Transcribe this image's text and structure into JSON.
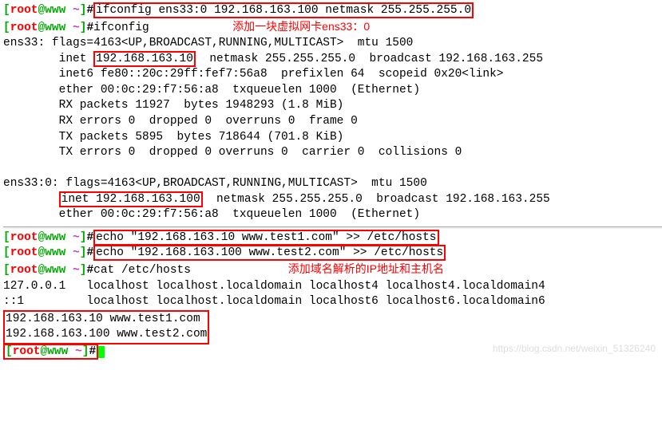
{
  "prompt": {
    "user": "root",
    "host": "www",
    "dir": "~",
    "sym": "#"
  },
  "cmd1": "ifconfig ens33:0 192.168.163.100 netmask 255.255.255.0",
  "cmd2": "ifconfig",
  "annotation1": "添加一块虚拟网卡ens33：0",
  "ens33": {
    "header": "ens33: flags=4163<UP,BROADCAST,RUNNING,MULTICAST>  mtu 1500",
    "inet_prefix": "        inet ",
    "inet_ip": "192.168.163.10",
    "inet_rest": "  netmask 255.255.255.0  broadcast 192.168.163.255",
    "inet6": "        inet6 fe80::20c:29ff:fef7:56a8  prefixlen 64  scopeid 0x20<link>",
    "ether": "        ether 00:0c:29:f7:56:a8  txqueuelen 1000  (Ethernet)",
    "rxp": "        RX packets 11927  bytes 1948293 (1.8 MiB)",
    "rxe": "        RX errors 0  dropped 0  overruns 0  frame 0",
    "txp": "        TX packets 5895  bytes 718644 (701.8 KiB)",
    "txe": "        TX errors 0  dropped 0 overruns 0  carrier 0  collisions 0"
  },
  "ens33_0": {
    "header": "ens33:0: flags=4163<UP,BROADCAST,RUNNING,MULTICAST>  mtu 1500",
    "inet_prefix": "        ",
    "inet_box": "inet 192.168.163.100",
    "inet_rest": "  netmask 255.255.255.0  broadcast 192.168.163.255",
    "ether": "        ether 00:0c:29:f7:56:a8  txqueuelen 1000  (Ethernet)"
  },
  "cmd3": "echo \"192.168.163.10 www.test1.com\" >> /etc/hosts",
  "cmd4": "echo \"192.168.163.100 www.test2.com\" >> /etc/hosts",
  "cmd5": "cat /etc/hosts",
  "annotation2": "添加域名解析的IP地址和主机名",
  "hosts": {
    "l1": "127.0.0.1   localhost localhost.localdomain localhost4 localhost4.localdomain4",
    "l2": "::1         localhost localhost.localdomain localhost6 localhost6.localdomain6",
    "l3": "192.168.163.10 www.test1.com",
    "l4": "192.168.163.100 www.test2.com"
  },
  "watermark": "https://blog.csdn.net/weixin_51326240"
}
